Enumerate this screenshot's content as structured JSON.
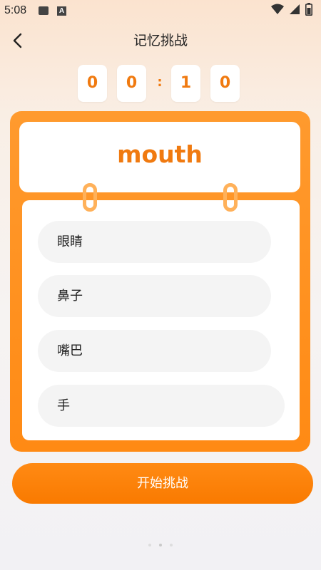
{
  "status_bar": {
    "time": "5:08",
    "icons": [
      "image-icon",
      "a-icon",
      "wifi-icon",
      "signal-icon",
      "battery-icon"
    ]
  },
  "header": {
    "title": "记忆挑战",
    "back_icon": "chevron-left-icon"
  },
  "timer": {
    "digits": [
      "0",
      "0",
      "1",
      "0"
    ],
    "separator": ":"
  },
  "card": {
    "word": "mouth",
    "options": [
      "眼睛",
      "鼻子",
      "嘴巴",
      "手"
    ]
  },
  "start_button": {
    "label": "开始挑战"
  },
  "colors": {
    "accent": "#ff8a14",
    "accent_text": "#f07a10",
    "option_bg": "#f4f4f4"
  }
}
